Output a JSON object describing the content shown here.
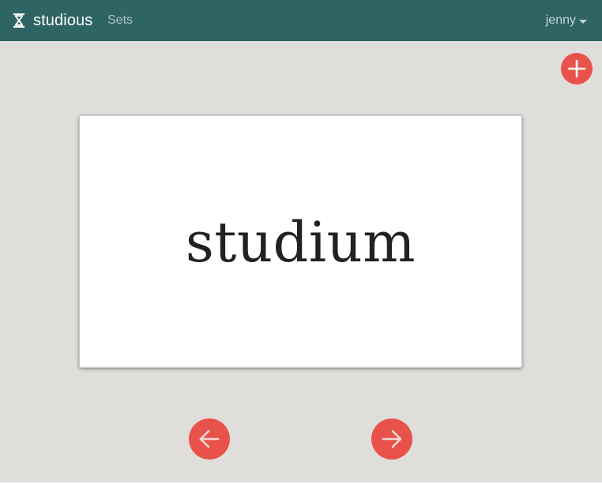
{
  "navbar": {
    "brand_icon": "hourglass-icon",
    "brand_name": "studious",
    "sets_link": "Sets",
    "user_name": "jenny",
    "user_menu_icon": "caret-down-icon",
    "background_color": "#2f6464"
  },
  "actions": {
    "add_icon": "plus-icon",
    "accent_color": "#e8524a"
  },
  "flashcard": {
    "term": "studium"
  },
  "navigation": {
    "prev_icon": "arrow-left-icon",
    "next_icon": "arrow-right-icon"
  }
}
